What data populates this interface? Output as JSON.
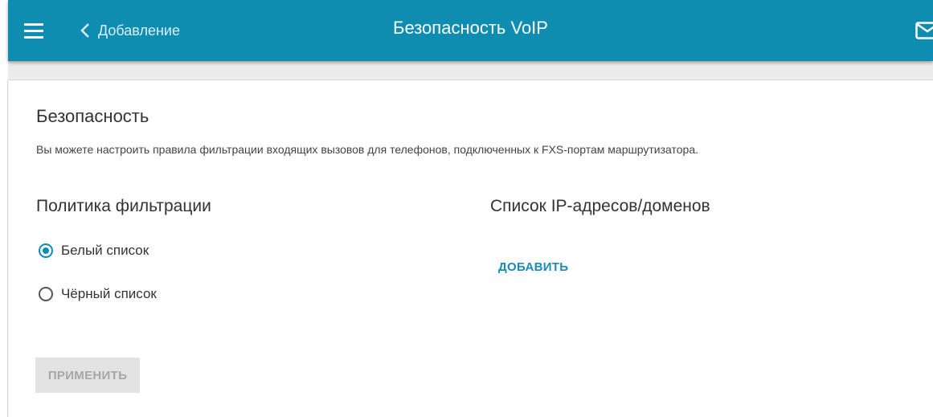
{
  "header": {
    "back_label": "Добавление",
    "title": "Безопасность VoIP",
    "menu_icon": "hamburger-icon",
    "back_icon": "chevron-left-icon",
    "mail_icon": "mail-icon",
    "accent_color": "#0f8db1"
  },
  "section": {
    "title": "Безопасность",
    "description": "Вы можете настроить правила фильтрации входящих вызовов для телефонов, подключенных к FXS-портам маршрутизатора."
  },
  "filter_policy": {
    "title": "Политика фильтрации",
    "options": [
      {
        "label": "Белый список",
        "checked": true
      },
      {
        "label": "Чёрный список",
        "checked": false
      }
    ]
  },
  "ip_list": {
    "title": "Список IP-адресов/доменов",
    "add_label": "ДОБАВИТЬ"
  },
  "apply_label": "ПРИМЕНИТЬ"
}
